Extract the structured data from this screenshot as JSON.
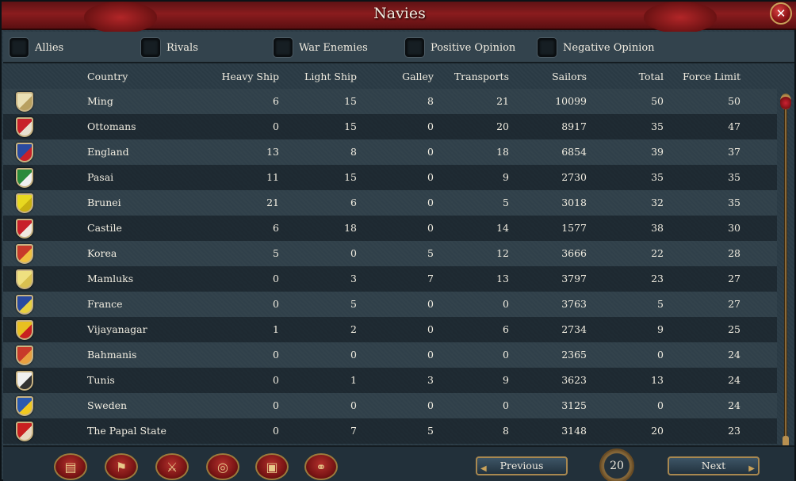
{
  "window": {
    "title": "Navies",
    "close_label": "✕"
  },
  "filters": [
    {
      "label": "Allies",
      "checked": false
    },
    {
      "label": "Rivals",
      "checked": false
    },
    {
      "label": "War Enemies",
      "checked": false
    },
    {
      "label": "Positive Opinion",
      "checked": false
    },
    {
      "label": "Negative Opinion",
      "checked": false
    }
  ],
  "table": {
    "columns": [
      "Country",
      "Heavy Ship",
      "Light Ship",
      "Galley",
      "Transports",
      "Sailors",
      "Total",
      "Force Limit"
    ],
    "rows": [
      {
        "country": "Ming",
        "heavy": "6",
        "light": "15",
        "galley": "8",
        "transports": "21",
        "sailors": "10099",
        "total": "50",
        "force_limit": "50",
        "flag_colors": [
          "#e9dfb4",
          "#b8a060"
        ]
      },
      {
        "country": "Ottomans",
        "heavy": "0",
        "light": "15",
        "galley": "0",
        "transports": "20",
        "sailors": "8917",
        "total": "35",
        "force_limit": "47",
        "flag_colors": [
          "#c8202a",
          "#e8e0d0"
        ]
      },
      {
        "country": "England",
        "heavy": "13",
        "light": "8",
        "galley": "0",
        "transports": "18",
        "sailors": "6854",
        "total": "39",
        "force_limit": "37",
        "flag_colors": [
          "#2a4aa0",
          "#c8202a"
        ]
      },
      {
        "country": "Pasai",
        "heavy": "11",
        "light": "15",
        "galley": "0",
        "transports": "9",
        "sailors": "2730",
        "total": "35",
        "force_limit": "35",
        "flag_colors": [
          "#2a8a3a",
          "#f0f0f0"
        ]
      },
      {
        "country": "Brunei",
        "heavy": "21",
        "light": "6",
        "galley": "0",
        "transports": "5",
        "sailors": "3018",
        "total": "32",
        "force_limit": "35",
        "flag_colors": [
          "#e8d820",
          "#c8b010"
        ]
      },
      {
        "country": "Castile",
        "heavy": "6",
        "light": "18",
        "galley": "0",
        "transports": "14",
        "sailors": "1577",
        "total": "38",
        "force_limit": "30",
        "flag_colors": [
          "#c8202a",
          "#f0e8e0"
        ]
      },
      {
        "country": "Korea",
        "heavy": "5",
        "light": "0",
        "galley": "5",
        "transports": "12",
        "sailors": "3666",
        "total": "22",
        "force_limit": "28",
        "flag_colors": [
          "#c83a2a",
          "#f0c040"
        ]
      },
      {
        "country": "Mamluks",
        "heavy": "0",
        "light": "3",
        "galley": "7",
        "transports": "13",
        "sailors": "3797",
        "total": "23",
        "force_limit": "27",
        "flag_colors": [
          "#efe080",
          "#d8c050"
        ]
      },
      {
        "country": "France",
        "heavy": "0",
        "light": "5",
        "galley": "0",
        "transports": "0",
        "sailors": "3763",
        "total": "5",
        "force_limit": "27",
        "flag_colors": [
          "#2a4aa0",
          "#e8d040"
        ]
      },
      {
        "country": "Vijayanagar",
        "heavy": "1",
        "light": "2",
        "galley": "0",
        "transports": "6",
        "sailors": "2734",
        "total": "9",
        "force_limit": "25",
        "flag_colors": [
          "#e8c020",
          "#c82020"
        ]
      },
      {
        "country": "Bahmanis",
        "heavy": "0",
        "light": "0",
        "galley": "0",
        "transports": "0",
        "sailors": "2365",
        "total": "0",
        "force_limit": "24",
        "flag_colors": [
          "#c83a2a",
          "#e8a040"
        ]
      },
      {
        "country": "Tunis",
        "heavy": "0",
        "light": "1",
        "galley": "3",
        "transports": "9",
        "sailors": "3623",
        "total": "13",
        "force_limit": "24",
        "flag_colors": [
          "#f0f0f0",
          "#333333"
        ]
      },
      {
        "country": "Sweden",
        "heavy": "0",
        "light": "0",
        "galley": "0",
        "transports": "0",
        "sailors": "3125",
        "total": "0",
        "force_limit": "24",
        "flag_colors": [
          "#2a5ab0",
          "#f0c820"
        ]
      },
      {
        "country": "The Papal State",
        "heavy": "0",
        "light": "7",
        "galley": "5",
        "transports": "8",
        "sailors": "3148",
        "total": "20",
        "force_limit": "23",
        "flag_colors": [
          "#c82020",
          "#e8d8c0"
        ]
      }
    ]
  },
  "toolbar": {
    "buttons": [
      {
        "name": "ledger-icon",
        "glyph": "▤"
      },
      {
        "name": "flag-icon",
        "glyph": "⚑"
      },
      {
        "name": "crossed-swords-icon",
        "glyph": "⚔"
      },
      {
        "name": "coins-icon",
        "glyph": "◎"
      },
      {
        "name": "crate-icon",
        "glyph": "▣"
      },
      {
        "name": "handshake-icon",
        "glyph": "⚭"
      }
    ]
  },
  "pagination": {
    "previous_label": "Previous",
    "next_label": "Next",
    "page": "20"
  }
}
